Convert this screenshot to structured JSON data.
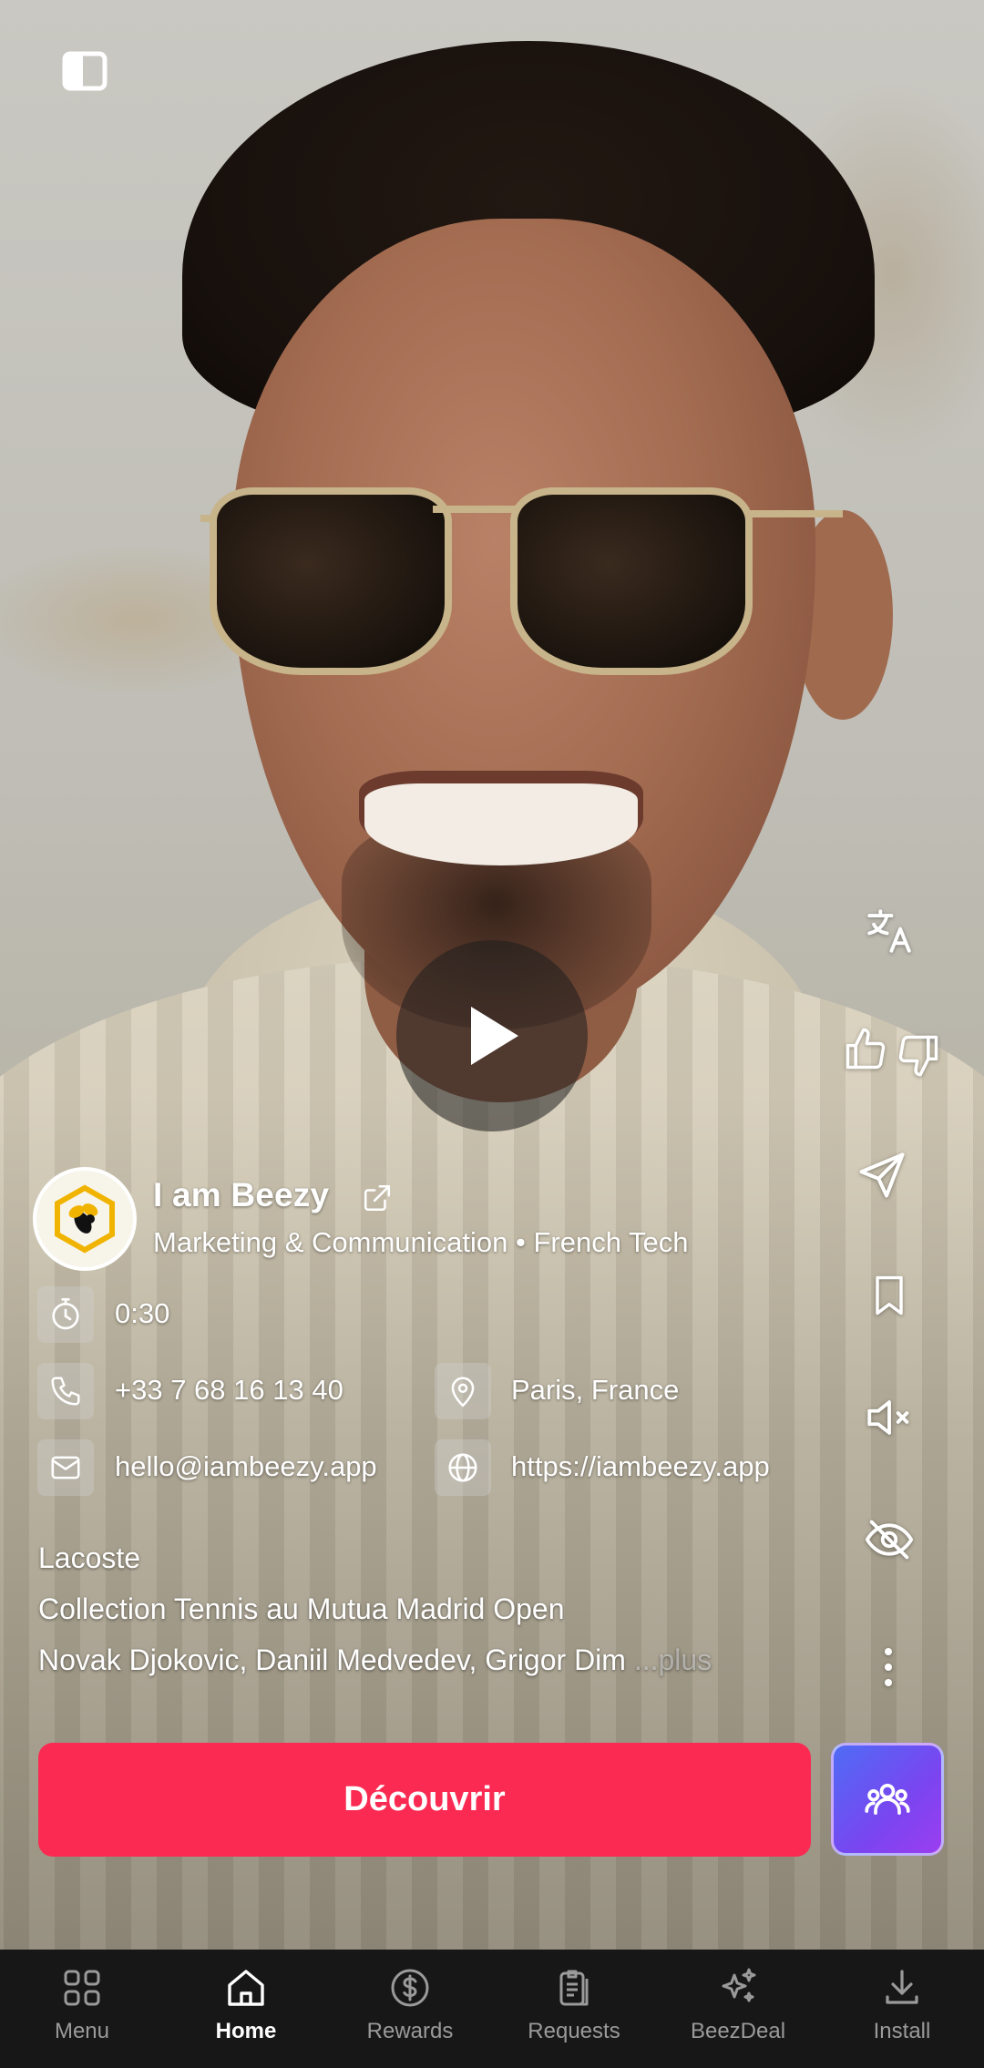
{
  "profile": {
    "name": "I am Beezy",
    "category": "Marketing & Communication",
    "separator": "•",
    "tag": "French Tech"
  },
  "details": {
    "duration": "0:30",
    "phone": "+33 7 68 16 13 40",
    "location": "Paris, France",
    "email": "hello@iambeezy.app",
    "website": "https://iambeezy.app"
  },
  "description": {
    "line1": "Lacoste",
    "line2": "Collection Tennis au Mutua Madrid Open",
    "line3": "Novak Djokovic, Daniil Medvedev, Grigor Dim",
    "more": " ...plus"
  },
  "cta": {
    "label": "Découvrir"
  },
  "nav": {
    "items": [
      {
        "label": "Menu",
        "icon": "grid-icon",
        "active": false
      },
      {
        "label": "Home",
        "icon": "home-icon",
        "active": true
      },
      {
        "label": "Rewards",
        "icon": "dollar-icon",
        "active": false
      },
      {
        "label": "Requests",
        "icon": "clipboard-icon",
        "active": false
      },
      {
        "label": "BeezDeal",
        "icon": "sparkles-icon",
        "active": false
      },
      {
        "label": "Install",
        "icon": "download-icon",
        "active": false
      }
    ]
  },
  "colors": {
    "cta": "#fa2a52",
    "group_button": "#7a45f0",
    "nav_background": "#171717"
  }
}
